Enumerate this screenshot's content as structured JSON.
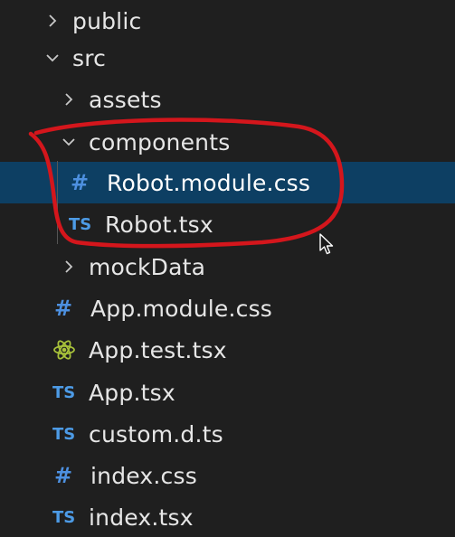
{
  "tree": {
    "rows": [
      {
        "label": "public",
        "kind": "folder",
        "expanded": false,
        "icon": "chevron-right-icon"
      },
      {
        "label": "src",
        "kind": "folder",
        "expanded": true,
        "icon": "chevron-down-icon"
      },
      {
        "label": "assets",
        "kind": "folder",
        "expanded": false,
        "icon": "chevron-right-icon"
      },
      {
        "label": "components",
        "kind": "folder",
        "expanded": true,
        "icon": "chevron-down-icon"
      },
      {
        "label": "Robot.module.css",
        "kind": "file",
        "icon_glyph": "#",
        "icon": "css-hash-icon",
        "selected": true
      },
      {
        "label": "Robot.tsx",
        "kind": "file",
        "icon_glyph": "TS",
        "icon": "typescript-icon"
      },
      {
        "label": "mockData",
        "kind": "folder",
        "expanded": false,
        "icon": "chevron-right-icon"
      },
      {
        "label": "App.module.css",
        "kind": "file",
        "icon_glyph": "#",
        "icon": "css-hash-icon"
      },
      {
        "label": "App.test.tsx",
        "kind": "file",
        "icon": "react-test-icon"
      },
      {
        "label": "App.tsx",
        "kind": "file",
        "icon_glyph": "TS",
        "icon": "typescript-icon"
      },
      {
        "label": "custom.d.ts",
        "kind": "file",
        "icon_glyph": "TS",
        "icon": "typescript-icon"
      },
      {
        "label": "index.css",
        "kind": "file",
        "icon_glyph": "#",
        "icon": "css-hash-icon"
      },
      {
        "label": "index.tsx",
        "kind": "file",
        "icon_glyph": "TS",
        "icon": "typescript-icon"
      }
    ]
  },
  "colors": {
    "background": "#1f1f1f",
    "selection": "#0d3f63",
    "css_icon": "#4d90e0",
    "ts_icon": "#4d9be6",
    "react_icon": "#a8c23a",
    "annotation": "#d4161c"
  }
}
